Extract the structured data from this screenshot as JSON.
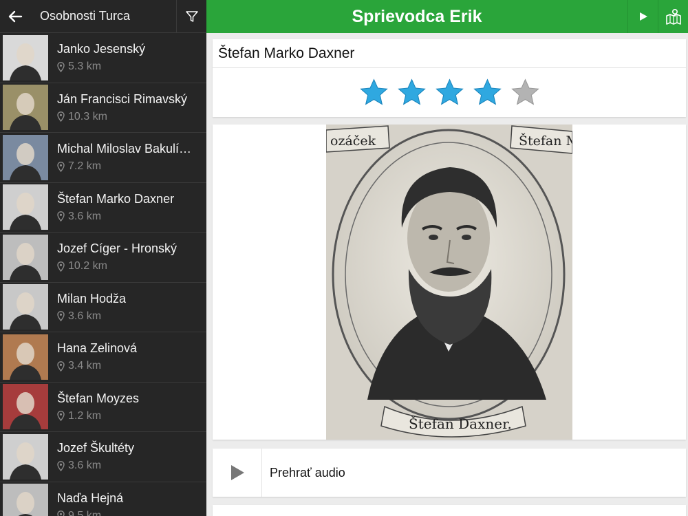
{
  "app": {
    "title": "Sprievodca Erik"
  },
  "sidebar": {
    "title": "Osobnosti Turca",
    "back_icon": "arrow-left-icon",
    "filter_icon": "filter-icon",
    "items": [
      {
        "name": "Janko Jesenský",
        "distance": "5.3 km",
        "thumb_bg": "#d9d9d9"
      },
      {
        "name": "Ján Francisci Rimavský",
        "distance": "10.3 km",
        "thumb_bg": "#9a9068"
      },
      {
        "name": "Michal Miloslav Bakulí…",
        "distance": "7.2 km",
        "thumb_bg": "#7a8aa0"
      },
      {
        "name": "Štefan Marko Daxner",
        "distance": "3.6 km",
        "thumb_bg": "#cfcfcf"
      },
      {
        "name": "Jozef Cíger - Hronský",
        "distance": "10.2 km",
        "thumb_bg": "#bdbdbd"
      },
      {
        "name": "Milan Hodža",
        "distance": "3.6 km",
        "thumb_bg": "#c8c8c8"
      },
      {
        "name": "Hana Zelinová",
        "distance": "3.4 km",
        "thumb_bg": "#b07a50"
      },
      {
        "name": "Štefan Moyzes",
        "distance": "1.2 km",
        "thumb_bg": "#a63c3c"
      },
      {
        "name": "Jozef Škultéty",
        "distance": "3.6 km",
        "thumb_bg": "#cfcfcf"
      },
      {
        "name": "Naďa Hejná",
        "distance": "9.5 km",
        "thumb_bg": "#bdbdbd"
      }
    ]
  },
  "topbar": {
    "play_icon": "play-icon",
    "map_icon": "map-icon"
  },
  "detail": {
    "title": "Štefan Marko Daxner",
    "rating": 4,
    "rating_max": 5,
    "star_filled_color": "#2fa8e0",
    "star_empty_color": "#b3b3b3",
    "portrait_caption": "Štefan Daxner.",
    "portrait_top_left": "ozáček",
    "portrait_top_right": "Štefan M"
  },
  "audio": {
    "label": "Prehrať audio",
    "icon": "play-icon"
  },
  "colors": {
    "accent": "#2aa53a",
    "sidebar_bg": "#262626"
  }
}
